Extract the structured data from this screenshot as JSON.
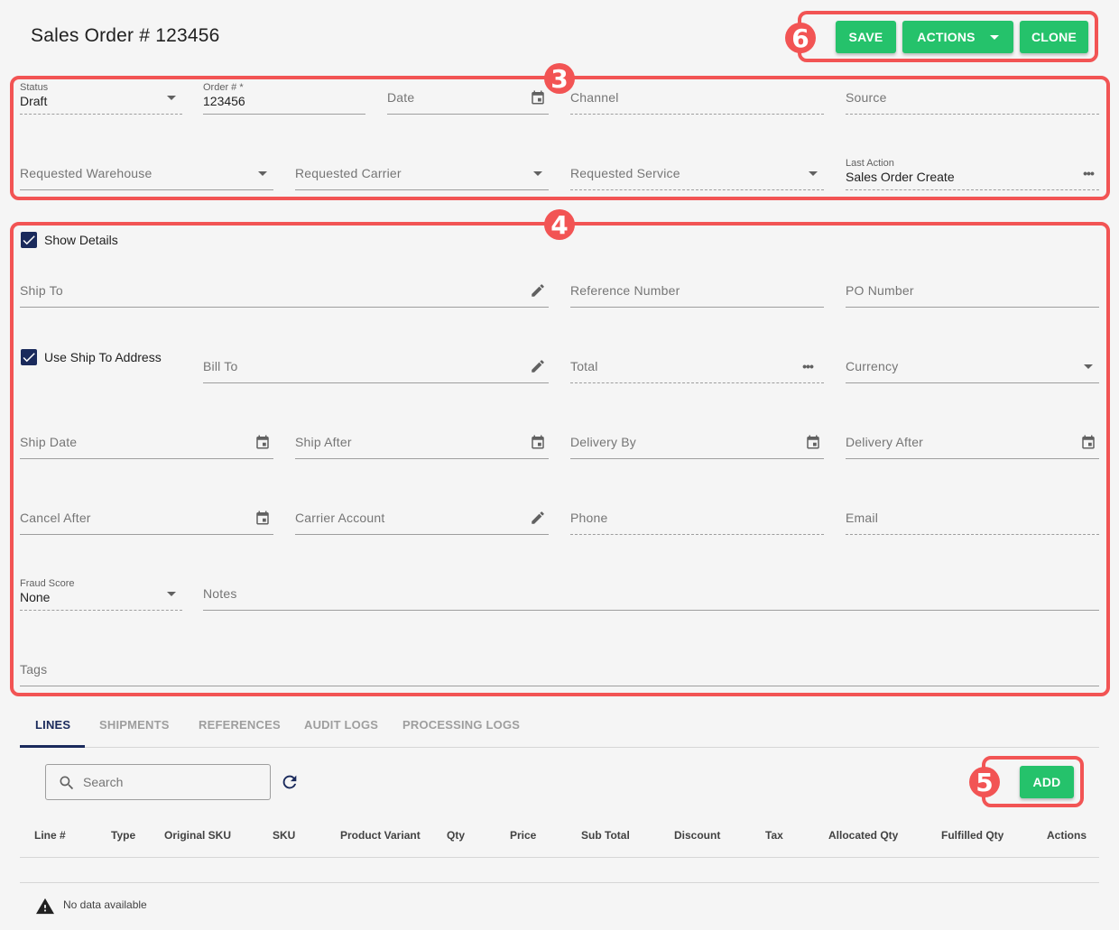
{
  "header": {
    "title": "Sales Order # 123456"
  },
  "toolbar": {
    "save_label": "SAVE",
    "actions_label": "ACTIONS",
    "clone_label": "CLONE"
  },
  "callouts": {
    "c3": "3",
    "c4": "4",
    "c5": "5",
    "c6": "6"
  },
  "order": {
    "status_label": "Status",
    "status_value": "Draft",
    "order_label": "Order # *",
    "order_value": "123456",
    "date_label": "Date",
    "channel_label": "Channel",
    "source_label": "Source",
    "warehouse_label": "Requested Warehouse",
    "carrier_label": "Requested Carrier",
    "service_label": "Requested Service",
    "last_action_label": "Last Action",
    "last_action_value": "Sales Order Create"
  },
  "details": {
    "show_details_label": "Show Details",
    "ship_to_label": "Ship To",
    "reference_number_label": "Reference Number",
    "po_number_label": "PO Number",
    "use_ship_to_label": "Use Ship To Address",
    "bill_to_label": "Bill To",
    "total_label": "Total",
    "currency_label": "Currency",
    "ship_date_label": "Ship Date",
    "ship_after_label": "Ship After",
    "delivery_by_label": "Delivery By",
    "delivery_after_label": "Delivery After",
    "cancel_after_label": "Cancel After",
    "carrier_account_label": "Carrier Account",
    "phone_label": "Phone",
    "email_label": "Email",
    "fraud_score_label": "Fraud Score",
    "fraud_score_value": "None",
    "notes_label": "Notes",
    "tags_label": "Tags"
  },
  "tabs": [
    "LINES",
    "SHIPMENTS",
    "REFERENCES",
    "AUDIT LOGS",
    "PROCESSING LOGS"
  ],
  "lines": {
    "search_placeholder": "Search",
    "add_label": "ADD",
    "columns": [
      "Line #",
      "Type",
      "Original SKU",
      "SKU",
      "Product Variant",
      "Qty",
      "Price",
      "Sub Total",
      "Discount",
      "Tax",
      "Allocated Qty",
      "Fulfilled Qty",
      "Actions"
    ],
    "empty_text": "No data available"
  },
  "colors": {
    "accent_green": "#25c26b",
    "callout_red": "#f25454",
    "navy": "#1a2a5c"
  }
}
